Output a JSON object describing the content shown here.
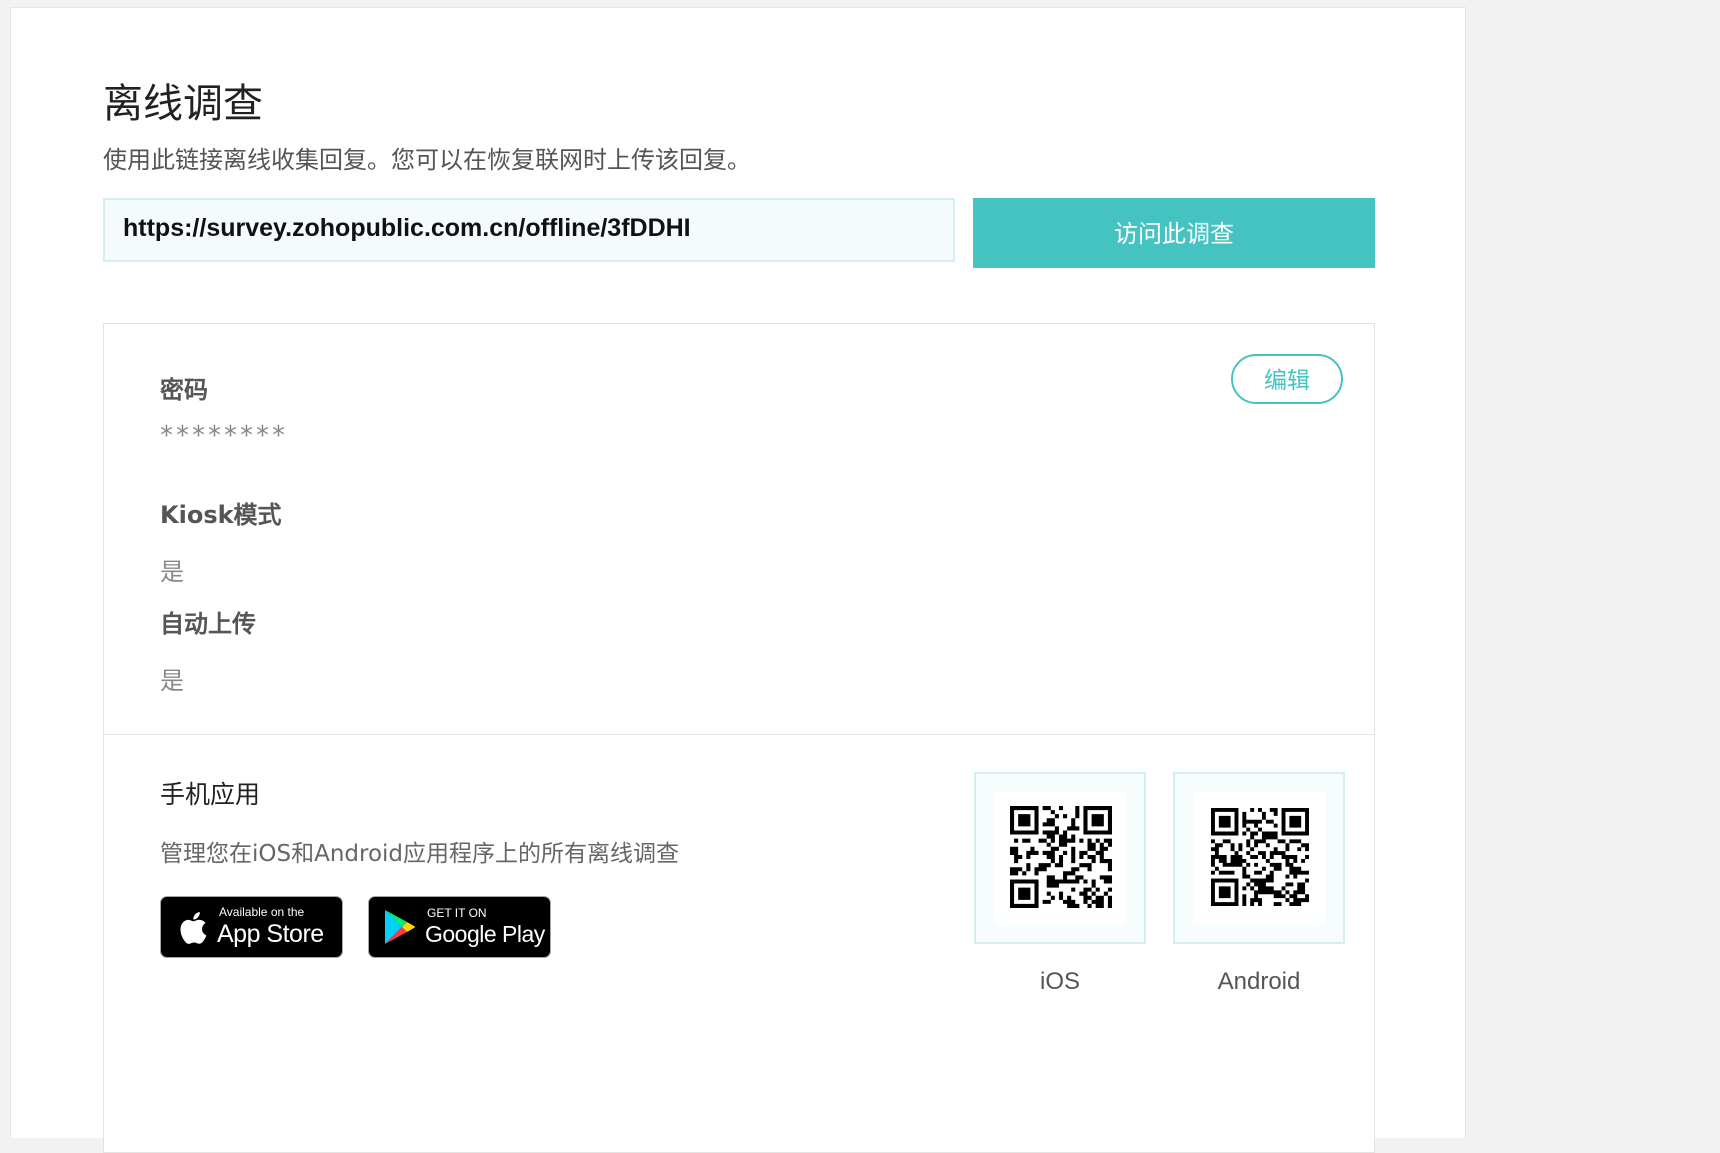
{
  "header": {
    "title": "离线调查",
    "description": "使用此链接离线收集回复。您可以在恢复联网时上传该回复。"
  },
  "link": {
    "url": "https://survey.zohopublic.com.cn/offline/3fDDHI",
    "visit_label": "访问此调查"
  },
  "settings": {
    "edit_label": "编辑",
    "password_label": "密码",
    "password_value": "********",
    "kiosk_label": "Kiosk模式",
    "kiosk_value": "是",
    "autoupload_label": "自动上传",
    "autoupload_value": "是"
  },
  "mobile": {
    "title": "手机应用",
    "description": "管理您在iOS和Android应用程序上的所有离线调查",
    "appstore_small": "Available on the",
    "appstore_big": "App Store",
    "googleplay_small": "GET IT ON",
    "googleplay_big": "Google Play",
    "qr_ios_label": "iOS",
    "qr_android_label": "Android"
  },
  "colors": {
    "accent": "#45c3c1",
    "url_box_bg": "#f5fbfc",
    "url_box_border": "#d6eef0"
  },
  "icons": {
    "appstore": "apple-icon",
    "googleplay": "google-play-icon",
    "qr": "qr-code-icon"
  }
}
